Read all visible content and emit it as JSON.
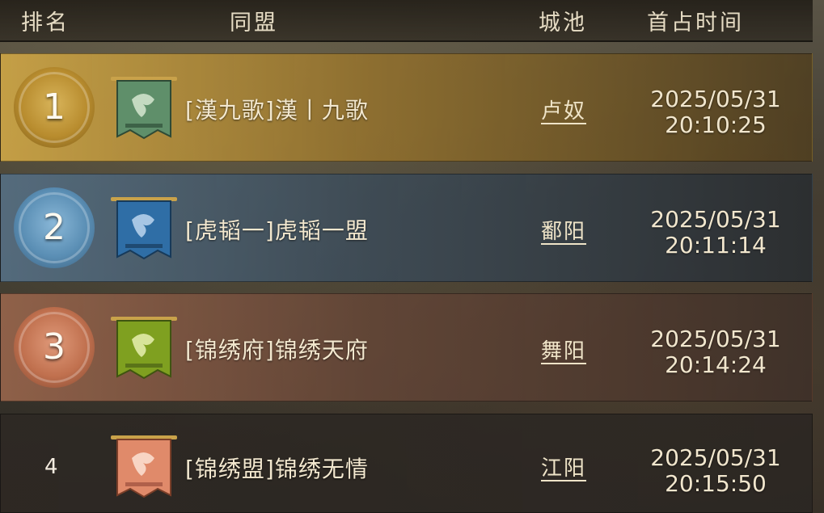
{
  "header": {
    "rank": "排名",
    "alliance": "同盟",
    "city": "城池",
    "first_time": "首占时间"
  },
  "rows": [
    {
      "rank": "1",
      "alliance": "[漢九歌]漢丨九歌",
      "city": "卢奴",
      "date": "2025/05/31",
      "time": "20:10:25",
      "banner_color": "#5f8f6a"
    },
    {
      "rank": "2",
      "alliance": "[虎韬一]虎韬一盟",
      "city": "鄱阳",
      "date": "2025/05/31",
      "time": "20:11:14",
      "banner_color": "#2f6ea6"
    },
    {
      "rank": "3",
      "alliance": "[锦绣府]锦绣天府",
      "city": "舞阳",
      "date": "2025/05/31",
      "time": "20:14:24",
      "banner_color": "#7fa020"
    },
    {
      "rank": "4",
      "alliance": "[锦绣盟]锦绣无情",
      "city": "江阳",
      "date": "2025/05/31",
      "time": "20:15:50",
      "banner_color": "#e08a6a"
    }
  ]
}
